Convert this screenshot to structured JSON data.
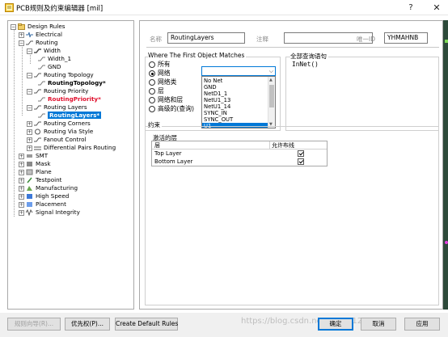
{
  "window": {
    "title": "PCB规则及约束编辑器 [mil]",
    "help_button": "?",
    "close_button": "✕"
  },
  "tree": {
    "root": "Design Rules",
    "items": [
      {
        "label": "Electrical"
      },
      {
        "label": "Routing"
      },
      {
        "label": "Width"
      },
      {
        "label": "Width_1"
      },
      {
        "label": "GND"
      },
      {
        "label": "Routing Topology"
      },
      {
        "label": "RoutingTopology*"
      },
      {
        "label": "Routing Priority"
      },
      {
        "label": "RoutingPriority*"
      },
      {
        "label": "Routing Layers"
      },
      {
        "label": "RoutingLayers*"
      },
      {
        "label": "Routing Corners"
      },
      {
        "label": "Routing Via Style"
      },
      {
        "label": "Fanout Control"
      },
      {
        "label": "Differential Pairs Routing"
      },
      {
        "label": "SMT"
      },
      {
        "label": "Mask"
      },
      {
        "label": "Plane"
      },
      {
        "label": "Testpoint"
      },
      {
        "label": "Manufacturing"
      },
      {
        "label": "High Speed"
      },
      {
        "label": "Placement"
      },
      {
        "label": "Signal Integrity"
      }
    ]
  },
  "rule": {
    "name_label": "名称",
    "name_value": "RoutingLayers",
    "comment_label": "注释",
    "comment_value": "",
    "uid_label": "唯一ID",
    "uid_value": "YHMAHNB"
  },
  "scope": {
    "group_title": "Where The First Object Matches",
    "options": [
      "所有",
      "网络",
      "网络类",
      "层",
      "网络和层",
      "高级的(查询)"
    ],
    "selected_index": 1,
    "dropdown_value": "",
    "dropdown_items": [
      "No Net",
      "GND",
      "NetD1_1",
      "NetU1_13",
      "NetU1_14",
      "SYNC_IN",
      "SYNC_OUT",
      "U1"
    ],
    "dropdown_selected_index": 7
  },
  "query": {
    "group_title": "全部查询语句",
    "text": "InNet()"
  },
  "constraints": {
    "group_title": "约束",
    "active_layers_label": "激活的层",
    "columns": [
      "层",
      "允许布线"
    ],
    "rows": [
      {
        "layer": "Top Layer",
        "allowed": true
      },
      {
        "layer": "Bottom Layer",
        "allowed": true
      }
    ]
  },
  "buttons": {
    "rule_wizard": "规则向导(R)...",
    "priority": "优先权(P)...",
    "create_default": "Create Default Rules",
    "ok": "确定",
    "cancel": "取消",
    "apply": "应用"
  },
  "watermark": "https://blog.csdn.net/qq_24123567"
}
